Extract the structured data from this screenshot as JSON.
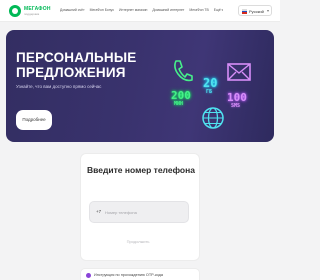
{
  "header": {
    "brand": "МЕГАФОН",
    "brand_sub": "поддержка",
    "nav": [
      "Домашний счёт",
      "МегаФон Бонус",
      "Интернет магазин",
      "Домашний интернет",
      "МегаФон ТВ",
      "Ещё"
    ],
    "language": "Русский",
    "colors": {
      "brand": "#00b956"
    }
  },
  "hero": {
    "title": "ПЕРСОНАЛЬНЫЕ ПРЕДЛОЖЕНИЯ",
    "subtitle": "Узнайте, что вам доступно прямо сейчас",
    "button": "Подробнее",
    "neon": {
      "minutes_value": "200",
      "minutes_label": "МИН",
      "gb_value": "20",
      "gb_label": "ГБ",
      "sms_value": "100",
      "sms_label": "SMS",
      "icons": [
        "phone-icon",
        "mail-icon",
        "globe-icon"
      ]
    },
    "colors": {
      "background": "#38316b",
      "neon_green": "#46f08a",
      "neon_blue": "#4fe3f0",
      "neon_purple": "#d78ef8"
    }
  },
  "login": {
    "title": "Введите номер телефона",
    "country_code": "+7",
    "phone_placeholder": "Номер телефона",
    "phone_value": "",
    "continue": "Продолжить"
  },
  "notice": {
    "text": "Инструкция по прохождению OTP-кода"
  }
}
